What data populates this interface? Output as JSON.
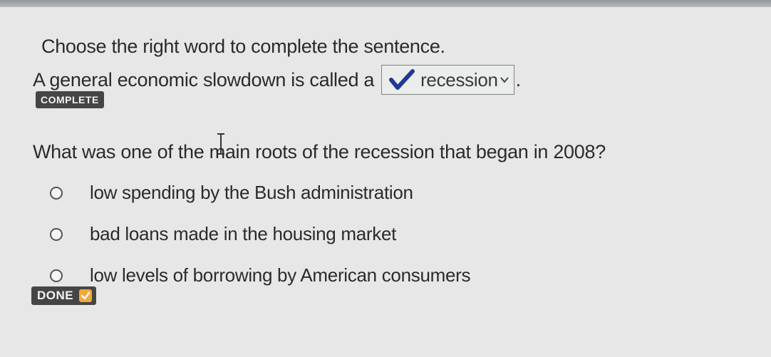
{
  "fill_in": {
    "instruction": "Choose the right word to complete the sentence.",
    "sentence_before": "A general economic slowdown is called a",
    "selected_value": "recession",
    "sentence_after": ".",
    "status_badge": "COMPLETE"
  },
  "question": {
    "text": "What was one of the main roots of the recession that began in 2008?",
    "options": [
      {
        "label": "low spending by the Bush administration"
      },
      {
        "label": "bad loans made in the housing market"
      },
      {
        "label": "low levels of borrowing by American consumers"
      }
    ],
    "done_label": "DONE"
  },
  "icons": {
    "dropdown_check": "check-icon",
    "dropdown_chevron": "chevron-down-icon",
    "text_cursor": "text-cursor-icon",
    "done_check": "check-icon"
  },
  "colors": {
    "background": "#e6e7e6",
    "badge": "#454545",
    "check_blue": "#1f3a93",
    "done_accent": "#f0a93a"
  }
}
